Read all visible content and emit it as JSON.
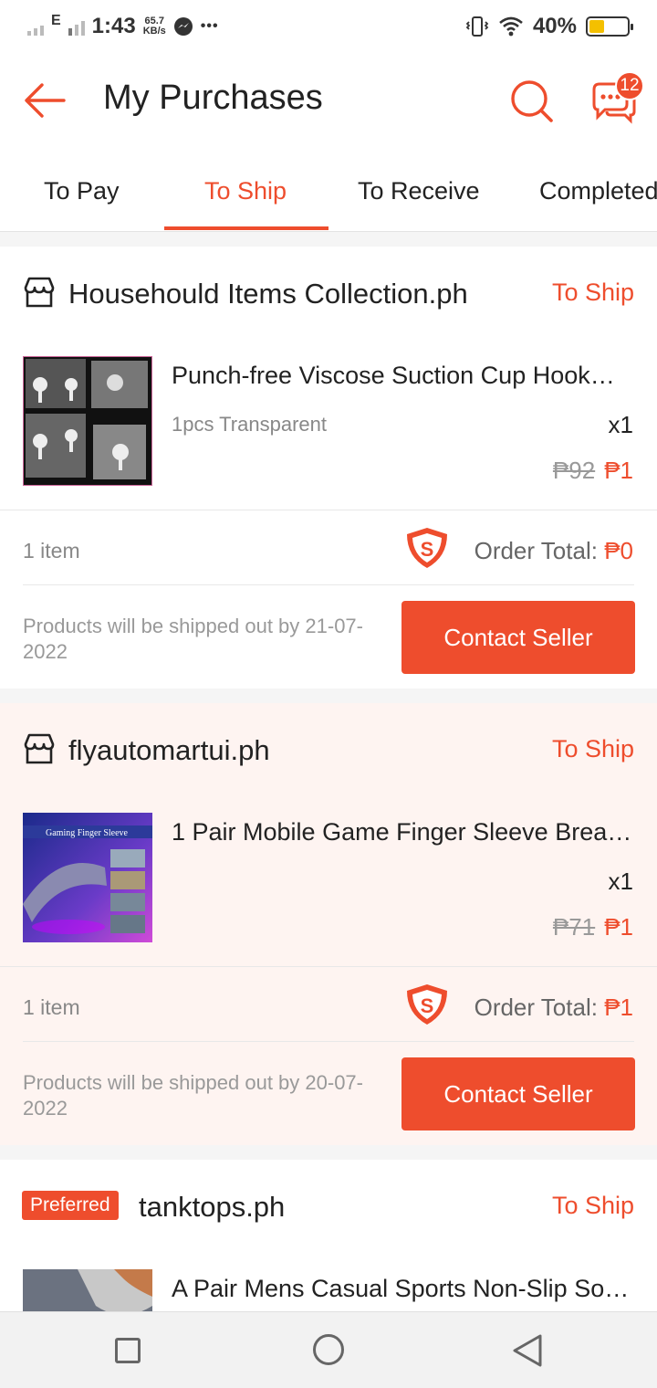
{
  "status_bar": {
    "network": "E",
    "time": "1:43",
    "speed_value": "65.7",
    "speed_unit": "KB/s",
    "extra": "•••",
    "battery": "40%",
    "battery_level": 0.4
  },
  "header": {
    "title": "My Purchases",
    "chat_badge": "12"
  },
  "tabs": [
    {
      "label": "To Pay"
    },
    {
      "label": "To Ship",
      "active": true
    },
    {
      "label": "To Receive"
    },
    {
      "label": "Completed"
    }
  ],
  "orders": [
    {
      "shop": "Househould Items Collection.ph",
      "status": "To Ship",
      "product_name": "Punch-free Viscose Suction Cup Hook…",
      "variation": "1pcs Transparent",
      "quantity": "x1",
      "original_price": "₱92",
      "price": "₱1",
      "item_count": "1 item",
      "order_total_label": "Order Total:",
      "order_total": "₱0",
      "ship_note": "Products will be shipped out by 21-07-2022",
      "button": "Contact Seller"
    },
    {
      "shop": "flyautomartui.ph",
      "status": "To Ship",
      "product_name": "1 Pair Mobile Game Finger Sleeve Brea…",
      "thumb_caption": "Gaming Finger Sleeve",
      "quantity": "x1",
      "original_price": "₱71",
      "price": "₱1",
      "item_count": "1 item",
      "order_total_label": "Order Total:",
      "order_total": "₱1",
      "ship_note": "Products will be shipped out by 20-07-2022",
      "button": "Contact Seller"
    },
    {
      "badge": "Preferred",
      "shop": "tanktops.ph",
      "status": "To Ship",
      "product_name": "A Pair Mens Casual Sports Non-Slip So…"
    }
  ],
  "colors": {
    "accent": "#ee4d2d",
    "highlight_card": "#fef4f1"
  }
}
